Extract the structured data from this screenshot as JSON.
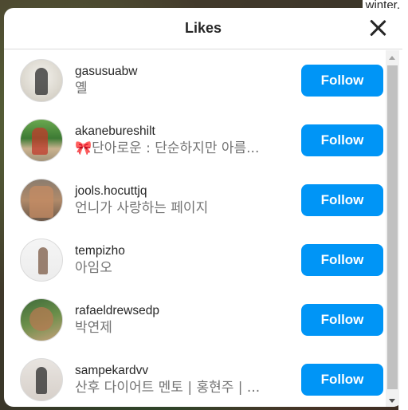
{
  "background": {
    "text": "winter."
  },
  "modal": {
    "title": "Likes",
    "close_icon": "close-icon"
  },
  "follow_label": "Follow",
  "colors": {
    "follow_button": "#0095f6",
    "username": "#262626",
    "fullname": "#737373"
  },
  "likes": [
    {
      "username": "gasusuabw",
      "fullname": "옐"
    },
    {
      "username": "akanebureshilt",
      "fullname": "🎀단아로운 : 단순하지만 아름..."
    },
    {
      "username": "jools.hocuttjq",
      "fullname": "언니가 사랑하는 페이지"
    },
    {
      "username": "tempizho",
      "fullname": "아임오"
    },
    {
      "username": "rafaeldrewsedp",
      "fullname": "박연제"
    },
    {
      "username": "sampekardvv",
      "fullname": "산후 다이어트 멘토 | 홍현주 | ..."
    }
  ]
}
